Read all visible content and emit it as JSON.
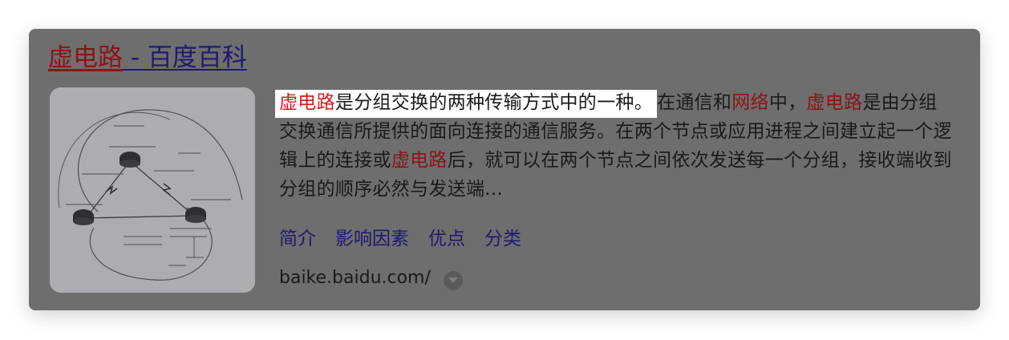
{
  "result": {
    "title_keyword": "虚电路",
    "title_rest": " - 百度百科",
    "abstract": {
      "p1_kw": "虚电路",
      "p1_text": "是分组交换的两种传输方式中的一种。",
      "p2_text": "在通信和",
      "p2_kw": "网络",
      "p3_text": "中，",
      "p3_kw": "虚电路",
      "p4_text": "是由分组交换通信所提供的面向连接的通信服务。在两个节点或应用进程之间建立起一个逻辑上的连接或",
      "p4_kw": "虚电路",
      "p5_text": "后，就可以在两个节点之间依次发送每一个分组，接收端收到分组的顺序必然与发送端..."
    },
    "links": [
      "简介",
      "影响因素",
      "优点",
      "分类"
    ],
    "source_url": "baike.baidu.com/"
  },
  "colors": {
    "card_bg": "#6e6e6e",
    "link": "#1d1a6d",
    "keyword_red": "#d41c1c",
    "keyword_dark": "#8b1414"
  },
  "icons": [
    "chevron-down-icon",
    "router-icon"
  ]
}
